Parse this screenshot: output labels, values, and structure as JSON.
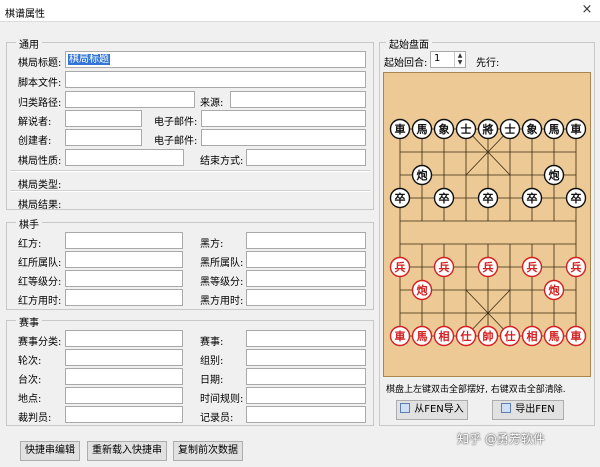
{
  "window": {
    "title": "棋谱属性",
    "close": "×"
  },
  "general": {
    "group_label": "通用",
    "title_label": "棋局标题:",
    "title_value": "棋局标题",
    "script_label": "脚本文件:",
    "category_label": "归类路径:",
    "source_label": "来源:",
    "commentator_label": "解说者:",
    "email1_label": "电子邮件:",
    "creator_label": "创建者:",
    "email2_label": "电子邮件:",
    "nature_label": "棋局性质:",
    "end_label": "结束方式:",
    "type_label": "棋局类型:",
    "result_label": "棋局结果:"
  },
  "players": {
    "group_label": "棋手",
    "red_label": "红方:",
    "black_label": "黑方:",
    "red_team_label": "红所属队:",
    "black_team_label": "黑所属队:",
    "red_rank_label": "红等级分:",
    "black_rank_label": "黑等级分:",
    "red_time_label": "红方用时:",
    "black_time_label": "黑方用时:"
  },
  "match": {
    "group_label": "赛事",
    "category_label": "赛事分类:",
    "event_label": "赛事:",
    "round_label": "轮次:",
    "group_field_label": "组别:",
    "table_label": "台次:",
    "date_label": "日期:",
    "venue_label": "地点:",
    "time_rule_label": "时间规则:",
    "referee_label": "裁判员:",
    "recorder_label": "记录员:"
  },
  "start_position": {
    "group_label": "起始盘面",
    "round_label": "起始回合:",
    "round_value": "1",
    "first_move_label": "先行:",
    "hint": "棋盘上左键双击全部摆好, 右键双击全部清除.",
    "import_button": "从FEN导入",
    "export_button": "导出FEN"
  },
  "bottom_buttons": {
    "quick_edit": "快捷串编辑",
    "reload": "重新载入快捷串",
    "copy_prev": "复制前次数据"
  },
  "watermark": "知乎 @勇芳软件",
  "chart_data": {
    "type": "table",
    "pieces": [
      {
        "side": "black",
        "char": "車",
        "file": 0,
        "rank": 0
      },
      {
        "side": "black",
        "char": "馬",
        "file": 1,
        "rank": 0
      },
      {
        "side": "black",
        "char": "象",
        "file": 2,
        "rank": 0
      },
      {
        "side": "black",
        "char": "士",
        "file": 3,
        "rank": 0
      },
      {
        "side": "black",
        "char": "將",
        "file": 4,
        "rank": 0
      },
      {
        "side": "black",
        "char": "士",
        "file": 5,
        "rank": 0
      },
      {
        "side": "black",
        "char": "象",
        "file": 6,
        "rank": 0
      },
      {
        "side": "black",
        "char": "馬",
        "file": 7,
        "rank": 0
      },
      {
        "side": "black",
        "char": "車",
        "file": 8,
        "rank": 0
      },
      {
        "side": "black",
        "char": "炮",
        "file": 1,
        "rank": 2
      },
      {
        "side": "black",
        "char": "炮",
        "file": 7,
        "rank": 2
      },
      {
        "side": "black",
        "char": "卒",
        "file": 0,
        "rank": 3
      },
      {
        "side": "black",
        "char": "卒",
        "file": 2,
        "rank": 3
      },
      {
        "side": "black",
        "char": "卒",
        "file": 4,
        "rank": 3
      },
      {
        "side": "black",
        "char": "卒",
        "file": 6,
        "rank": 3
      },
      {
        "side": "black",
        "char": "卒",
        "file": 8,
        "rank": 3
      },
      {
        "side": "red",
        "char": "兵",
        "file": 0,
        "rank": 6
      },
      {
        "side": "red",
        "char": "兵",
        "file": 2,
        "rank": 6
      },
      {
        "side": "red",
        "char": "兵",
        "file": 4,
        "rank": 6
      },
      {
        "side": "red",
        "char": "兵",
        "file": 6,
        "rank": 6
      },
      {
        "side": "red",
        "char": "兵",
        "file": 8,
        "rank": 6
      },
      {
        "side": "red",
        "char": "炮",
        "file": 1,
        "rank": 7
      },
      {
        "side": "red",
        "char": "炮",
        "file": 7,
        "rank": 7
      },
      {
        "side": "red",
        "char": "車",
        "file": 0,
        "rank": 9
      },
      {
        "side": "red",
        "char": "馬",
        "file": 1,
        "rank": 9
      },
      {
        "side": "red",
        "char": "相",
        "file": 2,
        "rank": 9
      },
      {
        "side": "red",
        "char": "仕",
        "file": 3,
        "rank": 9
      },
      {
        "side": "red",
        "char": "帥",
        "file": 4,
        "rank": 9
      },
      {
        "side": "red",
        "char": "仕",
        "file": 5,
        "rank": 9
      },
      {
        "side": "red",
        "char": "相",
        "file": 6,
        "rank": 9
      },
      {
        "side": "red",
        "char": "馬",
        "file": 7,
        "rank": 9
      },
      {
        "side": "red",
        "char": "車",
        "file": 8,
        "rank": 9
      }
    ],
    "colors": {
      "red": "#d42020",
      "black": "#111111",
      "board": "#ecc995"
    }
  }
}
